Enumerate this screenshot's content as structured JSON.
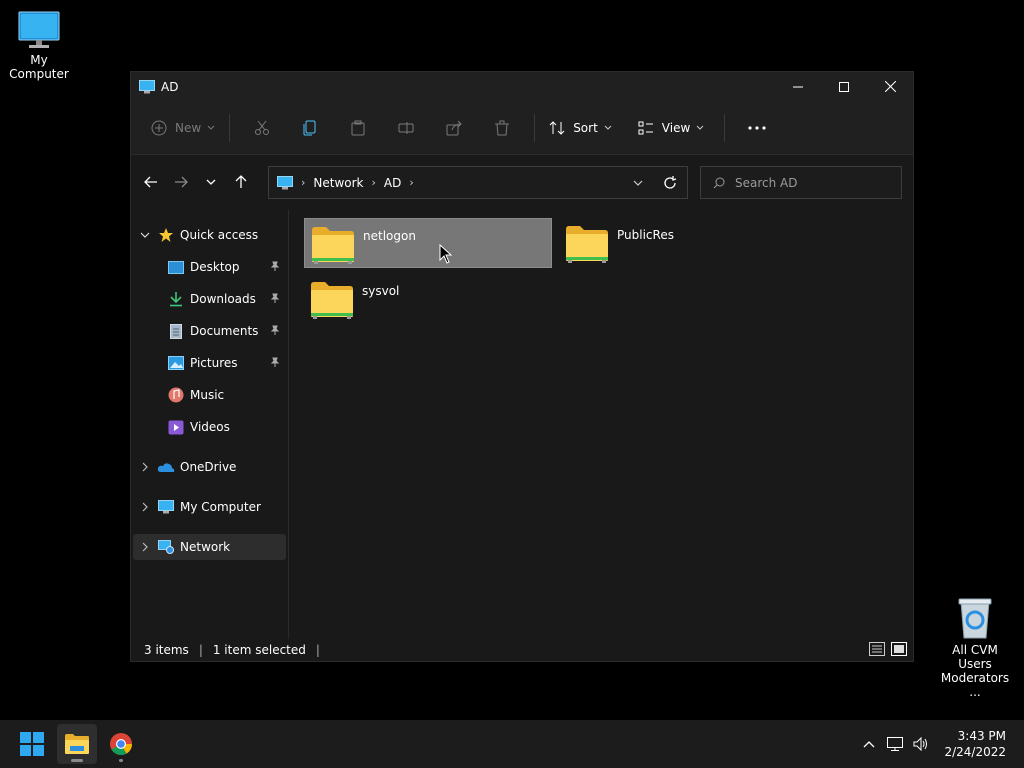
{
  "desktop": {
    "my_computer_label": "My Computer",
    "recycle_label_line1": "All CVM Users",
    "recycle_label_line2": "Moderators ..."
  },
  "window": {
    "title": "AD",
    "toolbar": {
      "new_label": "New",
      "sort_label": "Sort",
      "view_label": "View"
    },
    "address": {
      "crumbs": [
        "Network",
        "AD"
      ]
    },
    "search": {
      "placeholder": "Search AD"
    },
    "sidebar": {
      "quick_access": "Quick access",
      "items": [
        {
          "label": "Desktop",
          "pinned": true
        },
        {
          "label": "Downloads",
          "pinned": true
        },
        {
          "label": "Documents",
          "pinned": true
        },
        {
          "label": "Pictures",
          "pinned": true
        },
        {
          "label": "Music",
          "pinned": false
        },
        {
          "label": "Videos",
          "pinned": false
        }
      ],
      "onedrive": "OneDrive",
      "my_computer": "My Computer",
      "network": "Network"
    },
    "files": [
      {
        "name": "netlogon",
        "selected": true
      },
      {
        "name": "PublicRes",
        "selected": false
      },
      {
        "name": "sysvol",
        "selected": false
      }
    ],
    "status": {
      "count": "3 items",
      "selection": "1 item selected"
    }
  },
  "taskbar": {
    "time": "3:43 PM",
    "date": "2/24/2022"
  },
  "colors": {
    "folder": "#f3c640",
    "folder_stripe": "#3fbf4c",
    "accent": "#4cc2ff"
  }
}
